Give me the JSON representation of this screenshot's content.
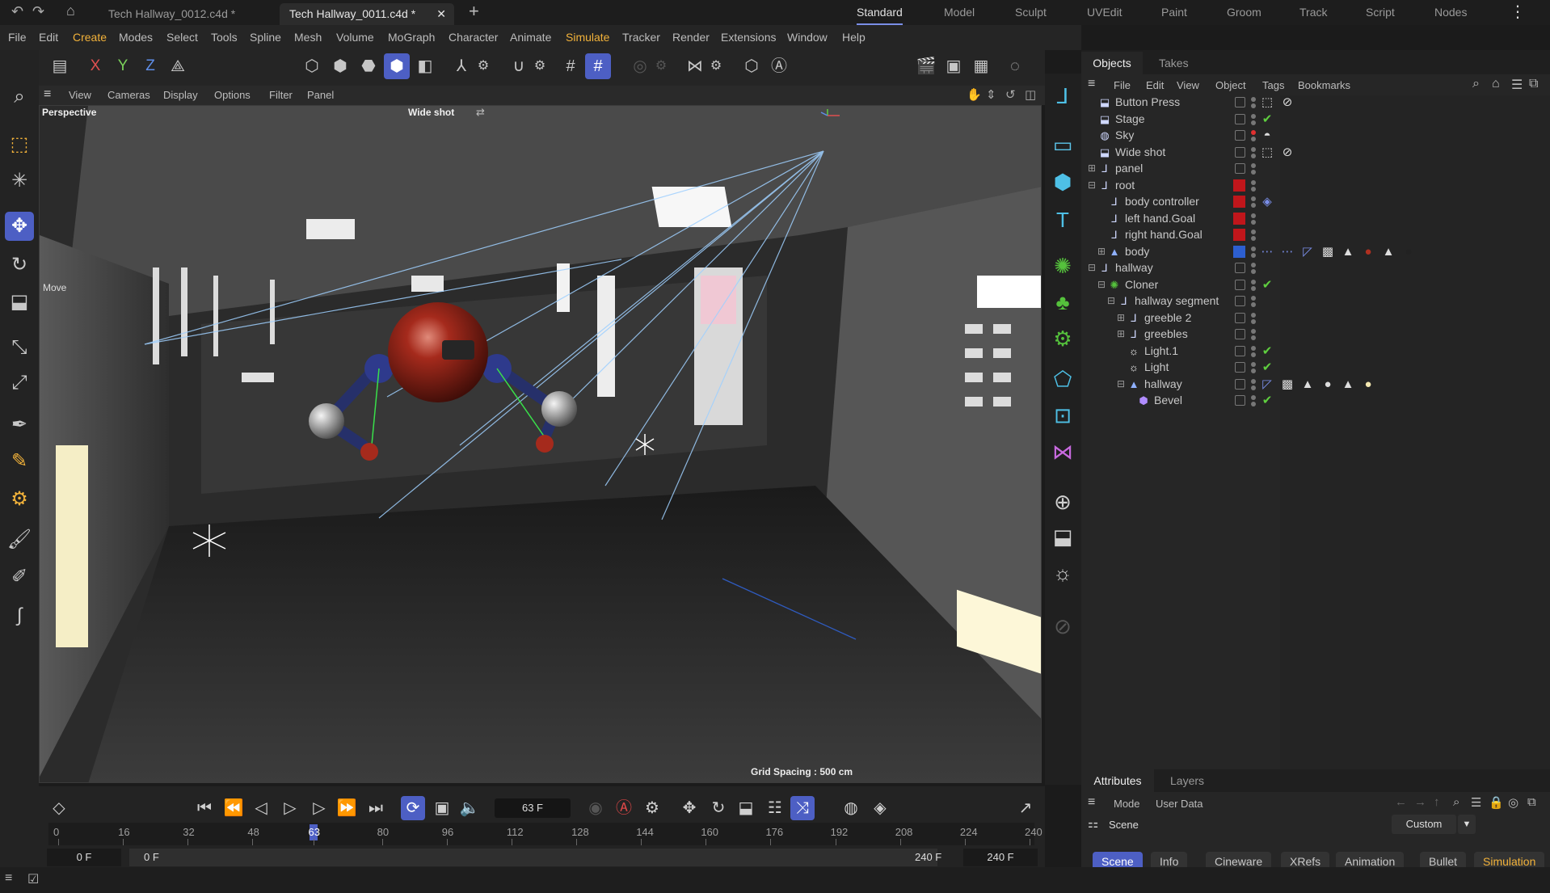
{
  "window_tabs": [
    {
      "label": "Tech Hallway_0012.c4d *"
    },
    {
      "label": "Tech Hallway_0011.c4d *"
    }
  ],
  "workspaces": [
    "Standard",
    "Model",
    "Sculpt",
    "UVEdit",
    "Paint",
    "Groom",
    "Track",
    "Script",
    "Nodes"
  ],
  "menus": [
    "File",
    "Edit",
    "Create",
    "Modes",
    "Select",
    "Tools",
    "Spline",
    "Mesh",
    "Volume",
    "MoGraph",
    "Character",
    "Animate",
    "Simulate",
    "Tracker",
    "Render",
    "Extensions",
    "Window",
    "Help"
  ],
  "highlight_menus": [
    "Create",
    "Simulate"
  ],
  "toolbar_axes": [
    "X",
    "Y",
    "Z"
  ],
  "viewport": {
    "menus": [
      "View",
      "Cameras",
      "Display",
      "Options",
      "Filter",
      "Panel"
    ],
    "label": "Perspective",
    "camera": "Wide shot",
    "move_label": "Move",
    "grid_spacing": "Grid Spacing : 500 cm"
  },
  "object_manager": {
    "tabs": [
      "Objects",
      "Takes"
    ],
    "menus": [
      "File",
      "Edit",
      "View",
      "Object",
      "Tags",
      "Bookmarks"
    ],
    "rows": [
      {
        "name": "Button Press",
        "depth": 0,
        "icon": "camera-icon",
        "expand": "",
        "layer": ""
      },
      {
        "name": "Stage",
        "depth": 0,
        "icon": "stage-icon",
        "expand": "",
        "layer": ""
      },
      {
        "name": "Sky",
        "depth": 0,
        "icon": "sky-icon",
        "expand": "",
        "layer": ""
      },
      {
        "name": "Wide shot",
        "depth": 0,
        "icon": "camera-icon",
        "expand": "",
        "layer": ""
      },
      {
        "name": "panel",
        "depth": 0,
        "icon": "null-icon",
        "expand": "+",
        "layer": ""
      },
      {
        "name": "root",
        "depth": 0,
        "icon": "null-icon",
        "expand": "-",
        "layer": "#c0161b"
      },
      {
        "name": "body controller",
        "depth": 1,
        "icon": "null-icon",
        "expand": "",
        "layer": "#c0161b"
      },
      {
        "name": "left hand.Goal",
        "depth": 1,
        "icon": "null-icon",
        "expand": "",
        "layer": "#c0161b"
      },
      {
        "name": "right hand.Goal",
        "depth": 1,
        "icon": "null-icon",
        "expand": "",
        "layer": "#c0161b"
      },
      {
        "name": "body",
        "depth": 1,
        "icon": "polygon-icon",
        "expand": "+",
        "layer": "#2d5fd0"
      },
      {
        "name": "hallway",
        "depth": 0,
        "icon": "null-icon",
        "expand": "-",
        "layer": ""
      },
      {
        "name": "Cloner",
        "depth": 1,
        "icon": "cloner-icon",
        "expand": "-",
        "layer": ""
      },
      {
        "name": "hallway segment",
        "depth": 2,
        "icon": "null-icon",
        "expand": "-",
        "layer": ""
      },
      {
        "name": "greeble 2",
        "depth": 3,
        "icon": "null-icon",
        "expand": "+",
        "layer": ""
      },
      {
        "name": "greebles",
        "depth": 3,
        "icon": "null-icon",
        "expand": "+",
        "layer": ""
      },
      {
        "name": "Light.1",
        "depth": 3,
        "icon": "light-icon",
        "expand": "",
        "layer": ""
      },
      {
        "name": "Light",
        "depth": 3,
        "icon": "light-icon",
        "expand": "",
        "layer": ""
      },
      {
        "name": "hallway",
        "depth": 3,
        "icon": "polygon-icon",
        "expand": "-",
        "layer": ""
      },
      {
        "name": "Bevel",
        "depth": 4,
        "icon": "bevel-icon",
        "expand": "",
        "layer": ""
      }
    ]
  },
  "timeline": {
    "frame_field": "63 F",
    "ticks": [
      "0",
      "16",
      "32",
      "48",
      "63",
      "80",
      "96",
      "112",
      "128",
      "144",
      "160",
      "176",
      "192",
      "208",
      "224",
      "240"
    ],
    "current_frame": "63",
    "start_field": "0 F",
    "range_start": "0 F",
    "range_end": "240 F",
    "end_field": "240 F"
  },
  "attributes": {
    "tabs": [
      "Attributes",
      "Layers"
    ],
    "mode_label": "Mode",
    "user_data_label": "User Data",
    "scene_label": "Scene",
    "custom_label": "Custom",
    "scene_tabs": [
      "Scene",
      "Info",
      "Cineware",
      "XRefs",
      "Animation",
      "Bullet",
      "Simulation"
    ]
  },
  "colors": {
    "accent": "#4d5fc4",
    "cyan_icon": "#4ec0e6",
    "green_icon": "#55c23c",
    "orange_icon": "#f2b23a",
    "layer_red": "#c0161b",
    "layer_blue": "#2d5fd0",
    "check_green": "#5fcf3f"
  }
}
